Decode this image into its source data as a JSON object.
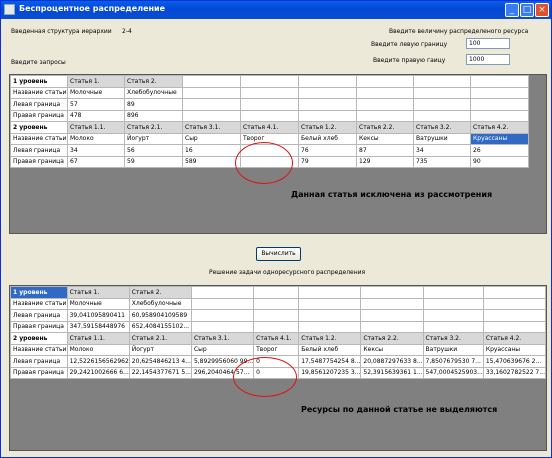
{
  "window": {
    "title": "Беспроцентное распределение"
  },
  "top": {
    "structure_label": "Введенная структура иерархии",
    "structure_value": "2-4",
    "resource_label": "Введите величину распределеного ресурса",
    "left_label": "Введите левую границу",
    "left_value": "100",
    "right_label": "Введите правую гаицу",
    "right_value": "1000",
    "queries_label": "Введите запросы"
  },
  "input_grid": {
    "level1": {
      "label": "1 уровень",
      "cols": [
        "Статья 1.",
        "Статья 2."
      ]
    },
    "level1_name_row": {
      "label": "Название статьи",
      "values": [
        "Молочные",
        "Хлебобулочные"
      ]
    },
    "level1_left_row": {
      "label": "Левая граница",
      "values": [
        "57",
        "89"
      ]
    },
    "level1_right_row": {
      "label": "Правая граница",
      "values": [
        "478",
        "896"
      ]
    },
    "level2": {
      "label": "2 уровень",
      "cols": [
        "Статья 1.1.",
        "Статья 2.1.",
        "Статья 3.1.",
        "Статья 4.1.",
        "Статья 1.2.",
        "Статья 2.2.",
        "Статья 3.2.",
        "Статья 4.2."
      ]
    },
    "level2_name_row": {
      "label": "Название статьи",
      "values": [
        "Молоко",
        "Йогурт",
        "Сыр",
        "Творог",
        "Белый хлеб",
        "Кексы",
        "Ватрушки",
        "Круассаны"
      ]
    },
    "level2_left_row": {
      "label": "Левая граница",
      "values": [
        "34",
        "56",
        "16",
        "",
        "76",
        "87",
        "34",
        "26"
      ]
    },
    "level2_right_row": {
      "label": "Правая граница",
      "values": [
        "67",
        "59",
        "589",
        "",
        "79",
        "129",
        "735",
        "90"
      ]
    }
  },
  "annotation1": "Данная статья исключена из рассмотрения",
  "calculate_button": "Вычислить",
  "result_title": "Решение задачи одноресурсного распределения",
  "result_grid": {
    "level1": {
      "label": "1 уровень",
      "cols": [
        "Статья 1.",
        "Статья 2."
      ]
    },
    "level1_name_row": {
      "label": "Название статьи",
      "values": [
        "Молочные",
        "Хлебобулочные"
      ]
    },
    "level1_left_row": {
      "label": "Левая граница",
      "values": [
        "39,041095890411",
        "60,958904109589"
      ]
    },
    "level1_right_row": {
      "label": "Правая граница",
      "values": [
        "347,59158448976",
        "652,4084155102..."
      ]
    },
    "level2": {
      "label": "2 уровень",
      "cols": [
        "Статья 1.1.",
        "Статья 2.1.",
        "Статья 3.1.",
        "Статья 4.1.",
        "Статья 1.2.",
        "Статья 2.2.",
        "Статья 3.2.",
        "Статья 4.2."
      ]
    },
    "level2_name_row": {
      "label": "Название статьи",
      "values": [
        "Молоко",
        "Йогурт",
        "Сыр",
        "Творог",
        "Белый хлеб",
        "Кексы",
        "Ватрушки",
        "Круассаны"
      ]
    },
    "level2_left_row": {
      "label": "Левая граница",
      "values": [
        "12,5226156562962",
        "20,6254846213 4...",
        "5,8929956060 99...",
        "0",
        "17,5487754254 8...",
        "20,0887297633 8...",
        "7,8507679530 7...",
        "15,470639676 2..."
      ]
    },
    "level2_right_row": {
      "label": "Правая граница",
      "values": [
        "29,2421002666 6...",
        "22,1454377671 5...",
        "296,2040464 57...",
        "0",
        "19,8561207235 3...",
        "52,3915639361 1...",
        "547,0004525903...",
        "33,1602782522 7..."
      ]
    }
  },
  "annotation2": "Ресурсы по данной статье не выделяются"
}
